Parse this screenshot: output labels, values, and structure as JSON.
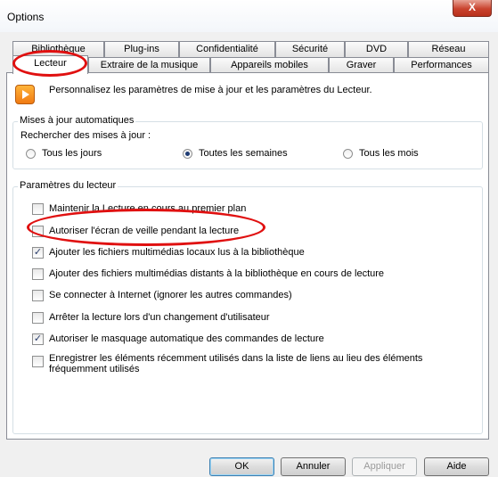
{
  "window": {
    "title": "Options",
    "close_glyph": "X"
  },
  "tabs_row1": [
    {
      "label": "Bibliothèque"
    },
    {
      "label": "Plug-ins"
    },
    {
      "label": "Confidentialité"
    },
    {
      "label": "Sécurité"
    },
    {
      "label": "DVD"
    },
    {
      "label": "Réseau"
    }
  ],
  "tabs_row2": [
    {
      "label": "Lecteur",
      "active": true
    },
    {
      "label": "Extraire de la musique"
    },
    {
      "label": "Appareils mobiles"
    },
    {
      "label": "Graver"
    },
    {
      "label": "Performances"
    }
  ],
  "panel": {
    "intro": "Personnalisez les paramètres de mise à jour et les paramètres du Lecteur.",
    "updates": {
      "legend": "Mises à jour automatiques",
      "prompt": "Rechercher des mises à jour :",
      "options": [
        {
          "label": "Tous les jours",
          "checked": false
        },
        {
          "label": "Toutes les semaines",
          "checked": true
        },
        {
          "label": "Tous les mois",
          "checked": false
        }
      ]
    },
    "player": {
      "legend": "Paramètres du lecteur",
      "checkboxes": [
        {
          "label": "Maintenir la Lecture en cours au premier plan",
          "checked": false
        },
        {
          "label": "Autoriser l'écran de veille pendant la lecture",
          "checked": false
        },
        {
          "label": "Ajouter les fichiers multimédias locaux lus à la bibliothèque",
          "checked": true
        },
        {
          "label": "Ajouter des fichiers multimédias distants à la bibliothèque en cours de lecture",
          "checked": false
        },
        {
          "label": "Se connecter à Internet (ignorer les autres commandes)",
          "checked": false
        },
        {
          "label": "Arrêter la lecture lors d'un changement d'utilisateur",
          "checked": false
        },
        {
          "label": "Autoriser le masquage automatique des commandes de lecture",
          "checked": true
        },
        {
          "label": "Enregistrer les éléments récemment utilisés dans la liste de liens au lieu des éléments",
          "label_line2": "fréquemment utilisés",
          "checked": false
        }
      ]
    }
  },
  "buttons": {
    "ok": "OK",
    "cancel": "Annuler",
    "apply": "Appliquer",
    "help": "Aide"
  },
  "check_glyph": "✓",
  "colors": {
    "annotation": "#e01010",
    "close": "#c9432e",
    "accent": "#3c7fb1"
  },
  "icons": {
    "app": "media-player-icon"
  }
}
